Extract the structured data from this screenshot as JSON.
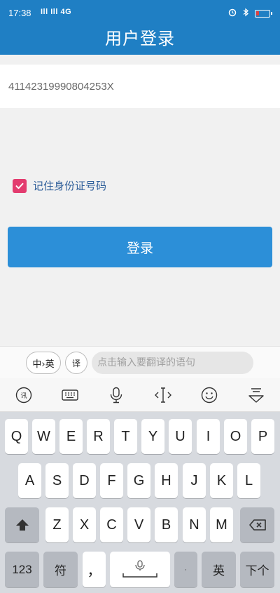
{
  "status_bar": {
    "time": "17:38",
    "signal_text": "Ill Ill 4G",
    "icons": [
      "alarm-icon",
      "bluetooth-icon",
      "battery-icon"
    ],
    "battery_level": 0.25
  },
  "header": {
    "title": "用户登录"
  },
  "form": {
    "id_number_value": "41142319990804253X",
    "remember_label": "记住身份证号码",
    "remember_checked": true,
    "login_button": "登录"
  },
  "keyboard": {
    "translate_bar": {
      "lang_toggle": "中›英",
      "translate_icon_text": "译",
      "input_placeholder": "点击输入要翻译的语句"
    },
    "toolbar": [
      "voice-translate-icon",
      "keyboard-icon",
      "microphone-icon",
      "cursor-icon",
      "emoji-icon",
      "collapse-keyboard-icon"
    ],
    "row1": [
      "Q",
      "W",
      "E",
      "R",
      "T",
      "Y",
      "U",
      "I",
      "O",
      "P"
    ],
    "row2": [
      "A",
      "S",
      "D",
      "F",
      "G",
      "H",
      "J",
      "K",
      "L"
    ],
    "row3": [
      "Z",
      "X",
      "C",
      "V",
      "B",
      "N",
      "M"
    ],
    "row4": {
      "num": "123",
      "symbol": "符",
      "comma": "，",
      "lang": "英",
      "next": "下个"
    }
  },
  "colors": {
    "header_bg": "#1f7fc4",
    "button_bg": "#2c8fd8",
    "checkbox": "#e33c6f"
  }
}
